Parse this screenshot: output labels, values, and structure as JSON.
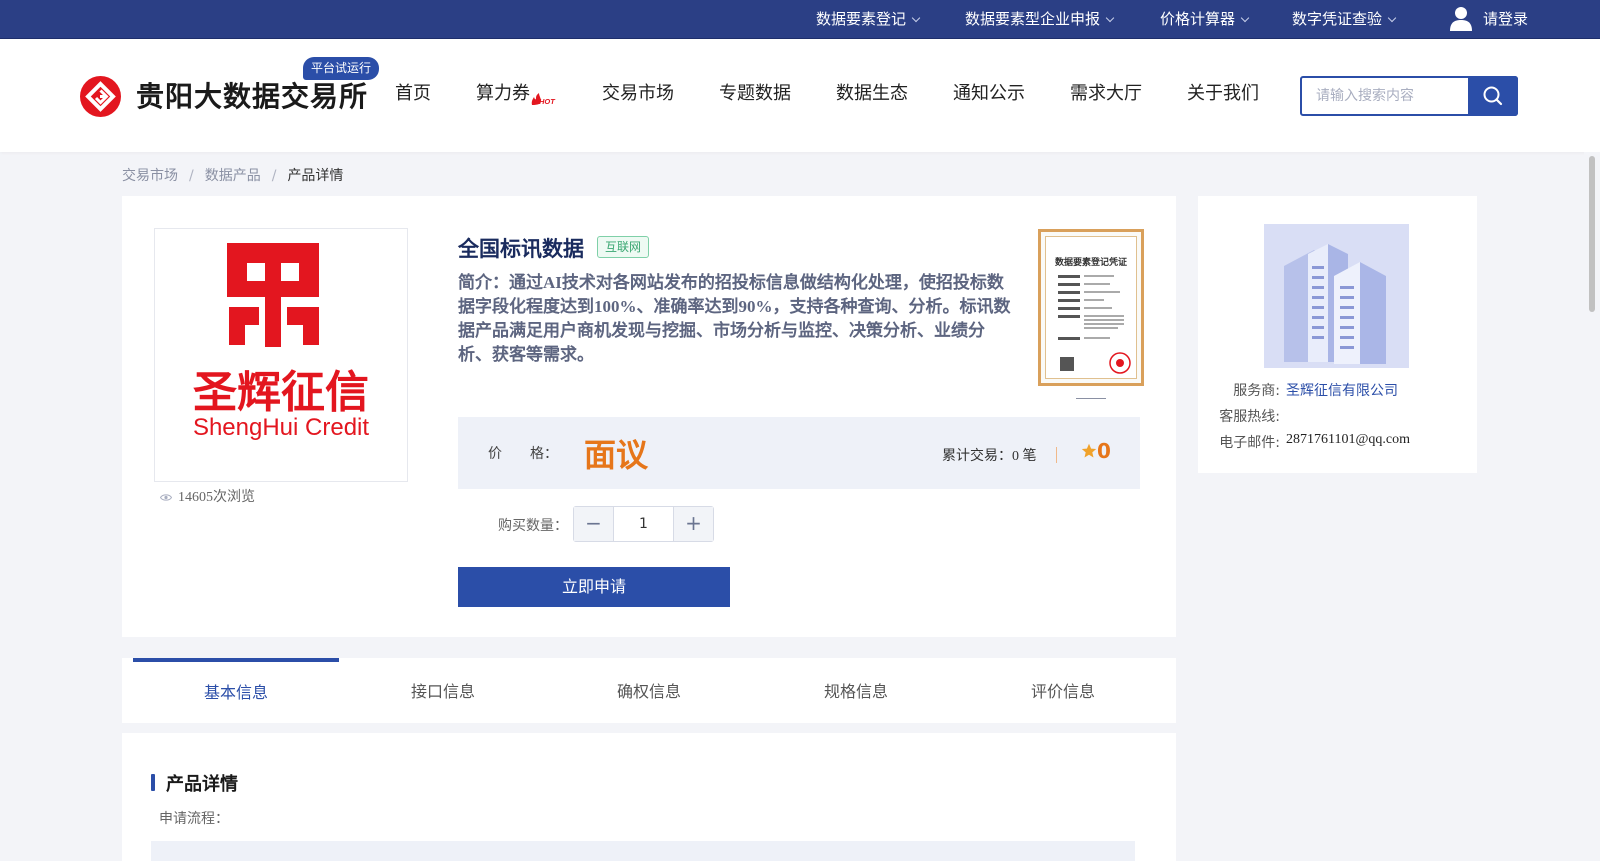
{
  "topbar": {
    "items": [
      {
        "label": "数据要素登记"
      },
      {
        "label": "数据要素型企业申报"
      },
      {
        "label": "价格计算器"
      },
      {
        "label": "数字凭证查验"
      }
    ],
    "login_label": "请登录"
  },
  "header": {
    "site_name": "贵阳大数据交易所",
    "trial_badge": "平台试运行",
    "nav": [
      "首页",
      "算力券",
      "交易市场",
      "专题数据",
      "数据生态",
      "通知公示",
      "需求大厅",
      "关于我们"
    ],
    "hot_badge": "HOT",
    "search_placeholder": "请输入搜索内容"
  },
  "breadcrumb": {
    "items": [
      "交易市场",
      "数据产品"
    ],
    "separator": "/",
    "current": "产品详情"
  },
  "product": {
    "logo_text_cn": "圣辉征信",
    "logo_text_en": "ShengHui Credit",
    "views": "14605次浏览",
    "title": "全国标讯数据",
    "category": "互联网",
    "intro": "简介：通过AI技术对各网站发布的招投标信息做结构化处理，使招投标数据字段化程度达到100%、准确率达到90%，支持各种查询、分析。标讯数据产品满足用户商机发现与挖掘、市场分析与监控、决策分析、业绩分析、获客等需求。",
    "certificate_title": "数据要素登记凭证",
    "price_label": "价　　格：",
    "price_value": "面议",
    "trades_label": "累计交易：",
    "trades_count": "0",
    "trades_unit": "笔",
    "rating": "0",
    "quantity_label": "购买数量：",
    "quantity": "1",
    "apply_button": "立即申请"
  },
  "provider": {
    "service_label": "服务商:",
    "service_value": "圣辉征信有限公司",
    "hotline_label": "客服热线:",
    "hotline_value": "",
    "email_label": "电子邮件:",
    "email_value": "2871761101@qq.com"
  },
  "tabs": [
    {
      "label": "基本信息",
      "active": true
    },
    {
      "label": "接口信息",
      "active": false
    },
    {
      "label": "确权信息",
      "active": false
    },
    {
      "label": "规格信息",
      "active": false
    },
    {
      "label": "评价信息",
      "active": false
    }
  ],
  "detail": {
    "heading": "产品详情",
    "apply_flow_label": "申请流程："
  },
  "colors": {
    "topbar": "#2b3f85",
    "accent": "#2b4ea8",
    "price": "#e6761a",
    "brand_red": "#e3161f"
  },
  "icons": [
    "user-icon",
    "search-icon",
    "eye-icon",
    "star-icon",
    "chevron-down-icon",
    "logo-mark-icon",
    "hot-icon",
    "building-illustration",
    "certificate-image"
  ]
}
